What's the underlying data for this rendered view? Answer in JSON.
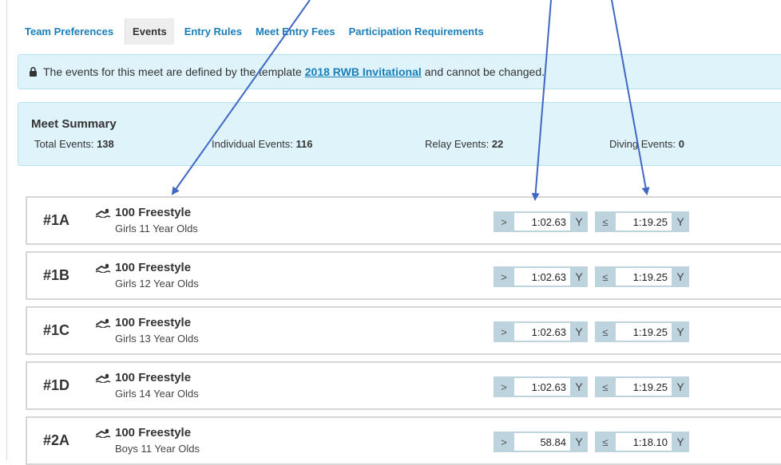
{
  "tabs": [
    {
      "label": "Team Preferences"
    },
    {
      "label": "Events"
    },
    {
      "label": "Entry Rules"
    },
    {
      "label": "Meet Entry Fees"
    },
    {
      "label": "Participation Requirements"
    }
  ],
  "notice": {
    "icon": "lock-icon",
    "text_before": "The events for this meet are defined by the template",
    "link": "2018 RWB Invitational",
    "text_after": "and cannot be changed."
  },
  "summary": {
    "title": "Meet Summary",
    "total_label": "Total Events:",
    "total_value": "138",
    "individual_label": "Individual Events:",
    "individual_value": "116",
    "relay_label": "Relay Events:",
    "relay_value": "22",
    "diving_label": "Diving Events:",
    "diving_value": "0"
  },
  "events": [
    {
      "number": "#1A",
      "name": "100 Freestyle",
      "group": "Girls 11 Year Olds",
      "lower_op": ">",
      "lower_time": "1:02.63",
      "lower_course": "Y",
      "upper_op": "≤",
      "upper_time": "1:19.25",
      "upper_course": "Y"
    },
    {
      "number": "#1B",
      "name": "100 Freestyle",
      "group": "Girls 12 Year Olds",
      "lower_op": ">",
      "lower_time": "1:02.63",
      "lower_course": "Y",
      "upper_op": "≤",
      "upper_time": "1:19.25",
      "upper_course": "Y"
    },
    {
      "number": "#1C",
      "name": "100 Freestyle",
      "group": "Girls 13 Year Olds",
      "lower_op": ">",
      "lower_time": "1:02.63",
      "lower_course": "Y",
      "upper_op": "≤",
      "upper_time": "1:19.25",
      "upper_course": "Y"
    },
    {
      "number": "#1D",
      "name": "100 Freestyle",
      "group": "Girls 14 Year Olds",
      "lower_op": ">",
      "lower_time": "1:02.63",
      "lower_course": "Y",
      "upper_op": "≤",
      "upper_time": "1:19.25",
      "upper_course": "Y"
    },
    {
      "number": "#2A",
      "name": "100 Freestyle",
      "group": "Boys 11 Year Olds",
      "lower_op": ">",
      "lower_time": "58.84",
      "lower_course": "Y",
      "upper_op": "≤",
      "upper_time": "1:18.10",
      "upper_course": "Y"
    }
  ],
  "colors": {
    "link": "#1a7fb8",
    "info_bg": "#dff3fb",
    "std_bg": "#bdd3dd",
    "annotation_arrow": "#3f67c4"
  },
  "event_icon": "swimmer-icon"
}
